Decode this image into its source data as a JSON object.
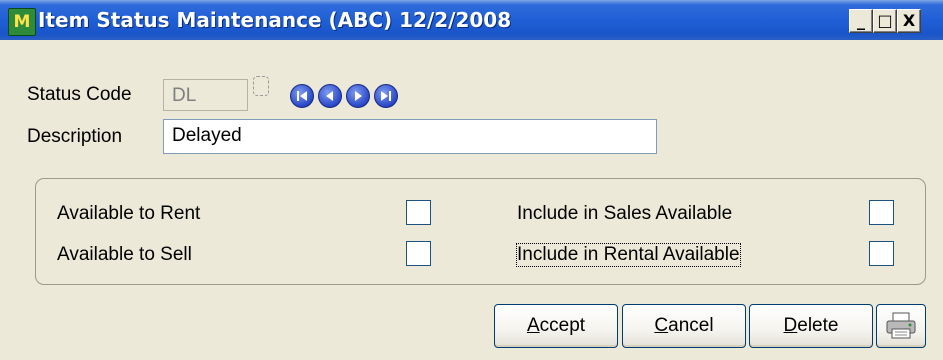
{
  "window": {
    "title": "Item Status Maintenance (ABC) 12/2/2008",
    "app_icon_glyph": "M",
    "minimize_glyph": "_",
    "maximize_glyph": "□",
    "close_glyph": "X"
  },
  "form": {
    "status_code_label": "Status Code",
    "status_code_value": "DL",
    "description_label": "Description",
    "description_value": "Delayed"
  },
  "options": {
    "available_to_rent_label": "Available to Rent",
    "available_to_sell_label": "Available to Sell",
    "include_sales_label": "Include in Sales Available",
    "include_rental_label": "Include in Rental Available",
    "available_to_rent_checked": false,
    "available_to_sell_checked": false,
    "include_sales_checked": false,
    "include_rental_checked": false
  },
  "buttons": {
    "accept_mnemonic": "A",
    "accept_rest": "ccept",
    "cancel_mnemonic": "C",
    "cancel_rest": "ancel",
    "delete_mnemonic": "D",
    "delete_rest": "elete"
  },
  "icons": {
    "app": "app-logo-icon",
    "lookup": "lookup-icon",
    "nav_first": "first-record-icon",
    "nav_prev": "previous-record-icon",
    "nav_next": "next-record-icon",
    "nav_last": "last-record-icon",
    "print": "printer-icon"
  },
  "colors": {
    "titlebar": "#1f5fd6",
    "window_bg": "#ece9d8",
    "nav_button": "#2a48c7"
  }
}
